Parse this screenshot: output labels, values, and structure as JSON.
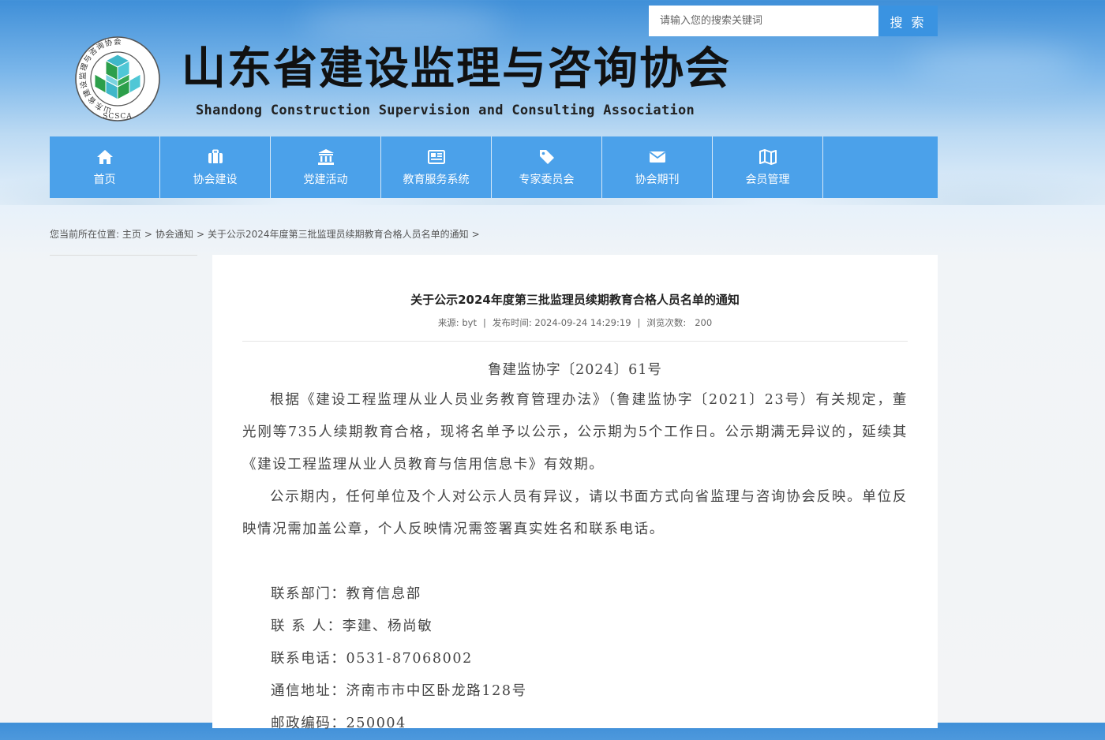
{
  "search": {
    "placeholder": "请输入您的搜索关键词",
    "button_label": "搜 索"
  },
  "header": {
    "title": "山东省建设监理与咨询协会",
    "subtitle": "Shandong Construction Supervision and Consulting Association",
    "logo": {
      "ring_text": "山东省建设监理与咨询协会",
      "abbr": "SCSCA"
    }
  },
  "nav": {
    "items": [
      {
        "label": "首页",
        "icon": "home-icon"
      },
      {
        "label": "协会建设",
        "icon": "briefcase-icon"
      },
      {
        "label": "党建活动",
        "icon": "institution-icon"
      },
      {
        "label": "教育服务系统",
        "icon": "newspaper-icon"
      },
      {
        "label": "专家委员会",
        "icon": "tag-icon"
      },
      {
        "label": "协会期刊",
        "icon": "envelope-icon"
      },
      {
        "label": "会员管理",
        "icon": "map-icon"
      }
    ]
  },
  "breadcrumb": {
    "prefix": "您当前所在位置:",
    "items": [
      "主页",
      "协会通知",
      "关于公示2024年度第三批监理员续期教育合格人员名单的通知"
    ],
    "separator": ">"
  },
  "article": {
    "title": "关于公示2024年度第三批监理员续期教育合格人员名单的通知",
    "meta": {
      "source": "来源: byt",
      "published": "发布时间: 2024-09-24 14:29:19",
      "views_label": "浏览次数:",
      "views": "200"
    },
    "doc_number": "鲁建监协字〔2024〕61号",
    "paragraphs": [
      "根据《建设工程监理从业人员业务教育管理办法》（鲁建监协字〔2021〕23号）有关规定，董光刚等735人续期教育合格，现将名单予以公示，公示期为5个工作日。公示期满无异议的，延续其《建设工程监理从业人员教育与信用信息卡》有效期。",
      "公示期内，任何单位及个人对公示人员有异议，请以书面方式向省监理与咨询协会反映。单位反映情况需加盖公章，个人反映情况需签署真实姓名和联系电话。"
    ],
    "contacts": [
      "联系部门：教育信息部",
      "联 系 人：李建、杨尚敏",
      "联系电话：0531-87068002",
      "通信地址：济南市市中区卧龙路128号",
      "邮政编码：250004"
    ]
  },
  "colors": {
    "nav_bg": "#4ba1ea",
    "search_button": "#3a93e1",
    "title_text": "#111111"
  }
}
